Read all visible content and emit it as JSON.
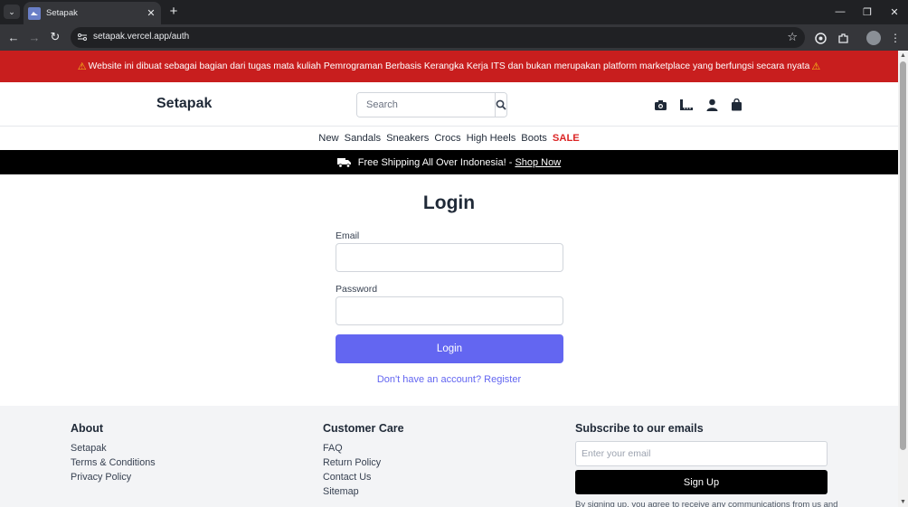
{
  "browser": {
    "tab_title": "Setapak",
    "url": "setapak.vercel.app/auth",
    "icons": [
      "tab-search-icon",
      "close-icon",
      "plus-icon",
      "back-icon",
      "forward-icon",
      "reload-icon",
      "site-info-icon",
      "star-icon",
      "extension-icon",
      "puzzle-icon",
      "menu-icon",
      "minimize-icon",
      "restore-icon",
      "close-window-icon"
    ]
  },
  "warning": {
    "text": "Website ini dibuat sebagai bagian dari tugas mata kuliah Pemrograman Berbasis Kerangka Kerja ITS dan bukan merupakan platform marketplace yang berfungsi secara nyata",
    "icon": "warning-icon"
  },
  "header": {
    "brand": "Setapak",
    "search_placeholder": "Search",
    "icons": [
      "camera-icon",
      "ruler-icon",
      "user-icon",
      "shopping-bag-icon"
    ]
  },
  "categories": [
    {
      "label": "New"
    },
    {
      "label": "Sandals"
    },
    {
      "label": "Sneakers"
    },
    {
      "label": "Crocs"
    },
    {
      "label": "High Heels"
    },
    {
      "label": "Boots"
    },
    {
      "label": "SALE"
    }
  ],
  "shipping": {
    "text": "Free Shipping All Over Indonesia! - ",
    "link": "Shop Now",
    "icon": "truck-icon"
  },
  "login": {
    "title": "Login",
    "email_label": "Email",
    "password_label": "Password",
    "button": "Login",
    "register_link": "Don't have an account? Register"
  },
  "footer": {
    "about": {
      "title": "About",
      "links": [
        "Setapak",
        "Terms & Conditions",
        "Privacy Policy"
      ]
    },
    "care": {
      "title": "Customer Care",
      "links": [
        "FAQ",
        "Return Policy",
        "Contact Us",
        "Sitemap"
      ]
    },
    "subscribe": {
      "title": "Subscribe to our emails",
      "placeholder": "Enter your email",
      "button": "Sign Up",
      "note": "By signing up, you agree to receive any communications from us and"
    }
  },
  "colors": {
    "warning_bg": "#c81e1e",
    "accent": "#6366f1",
    "sale": "#dc2626"
  }
}
